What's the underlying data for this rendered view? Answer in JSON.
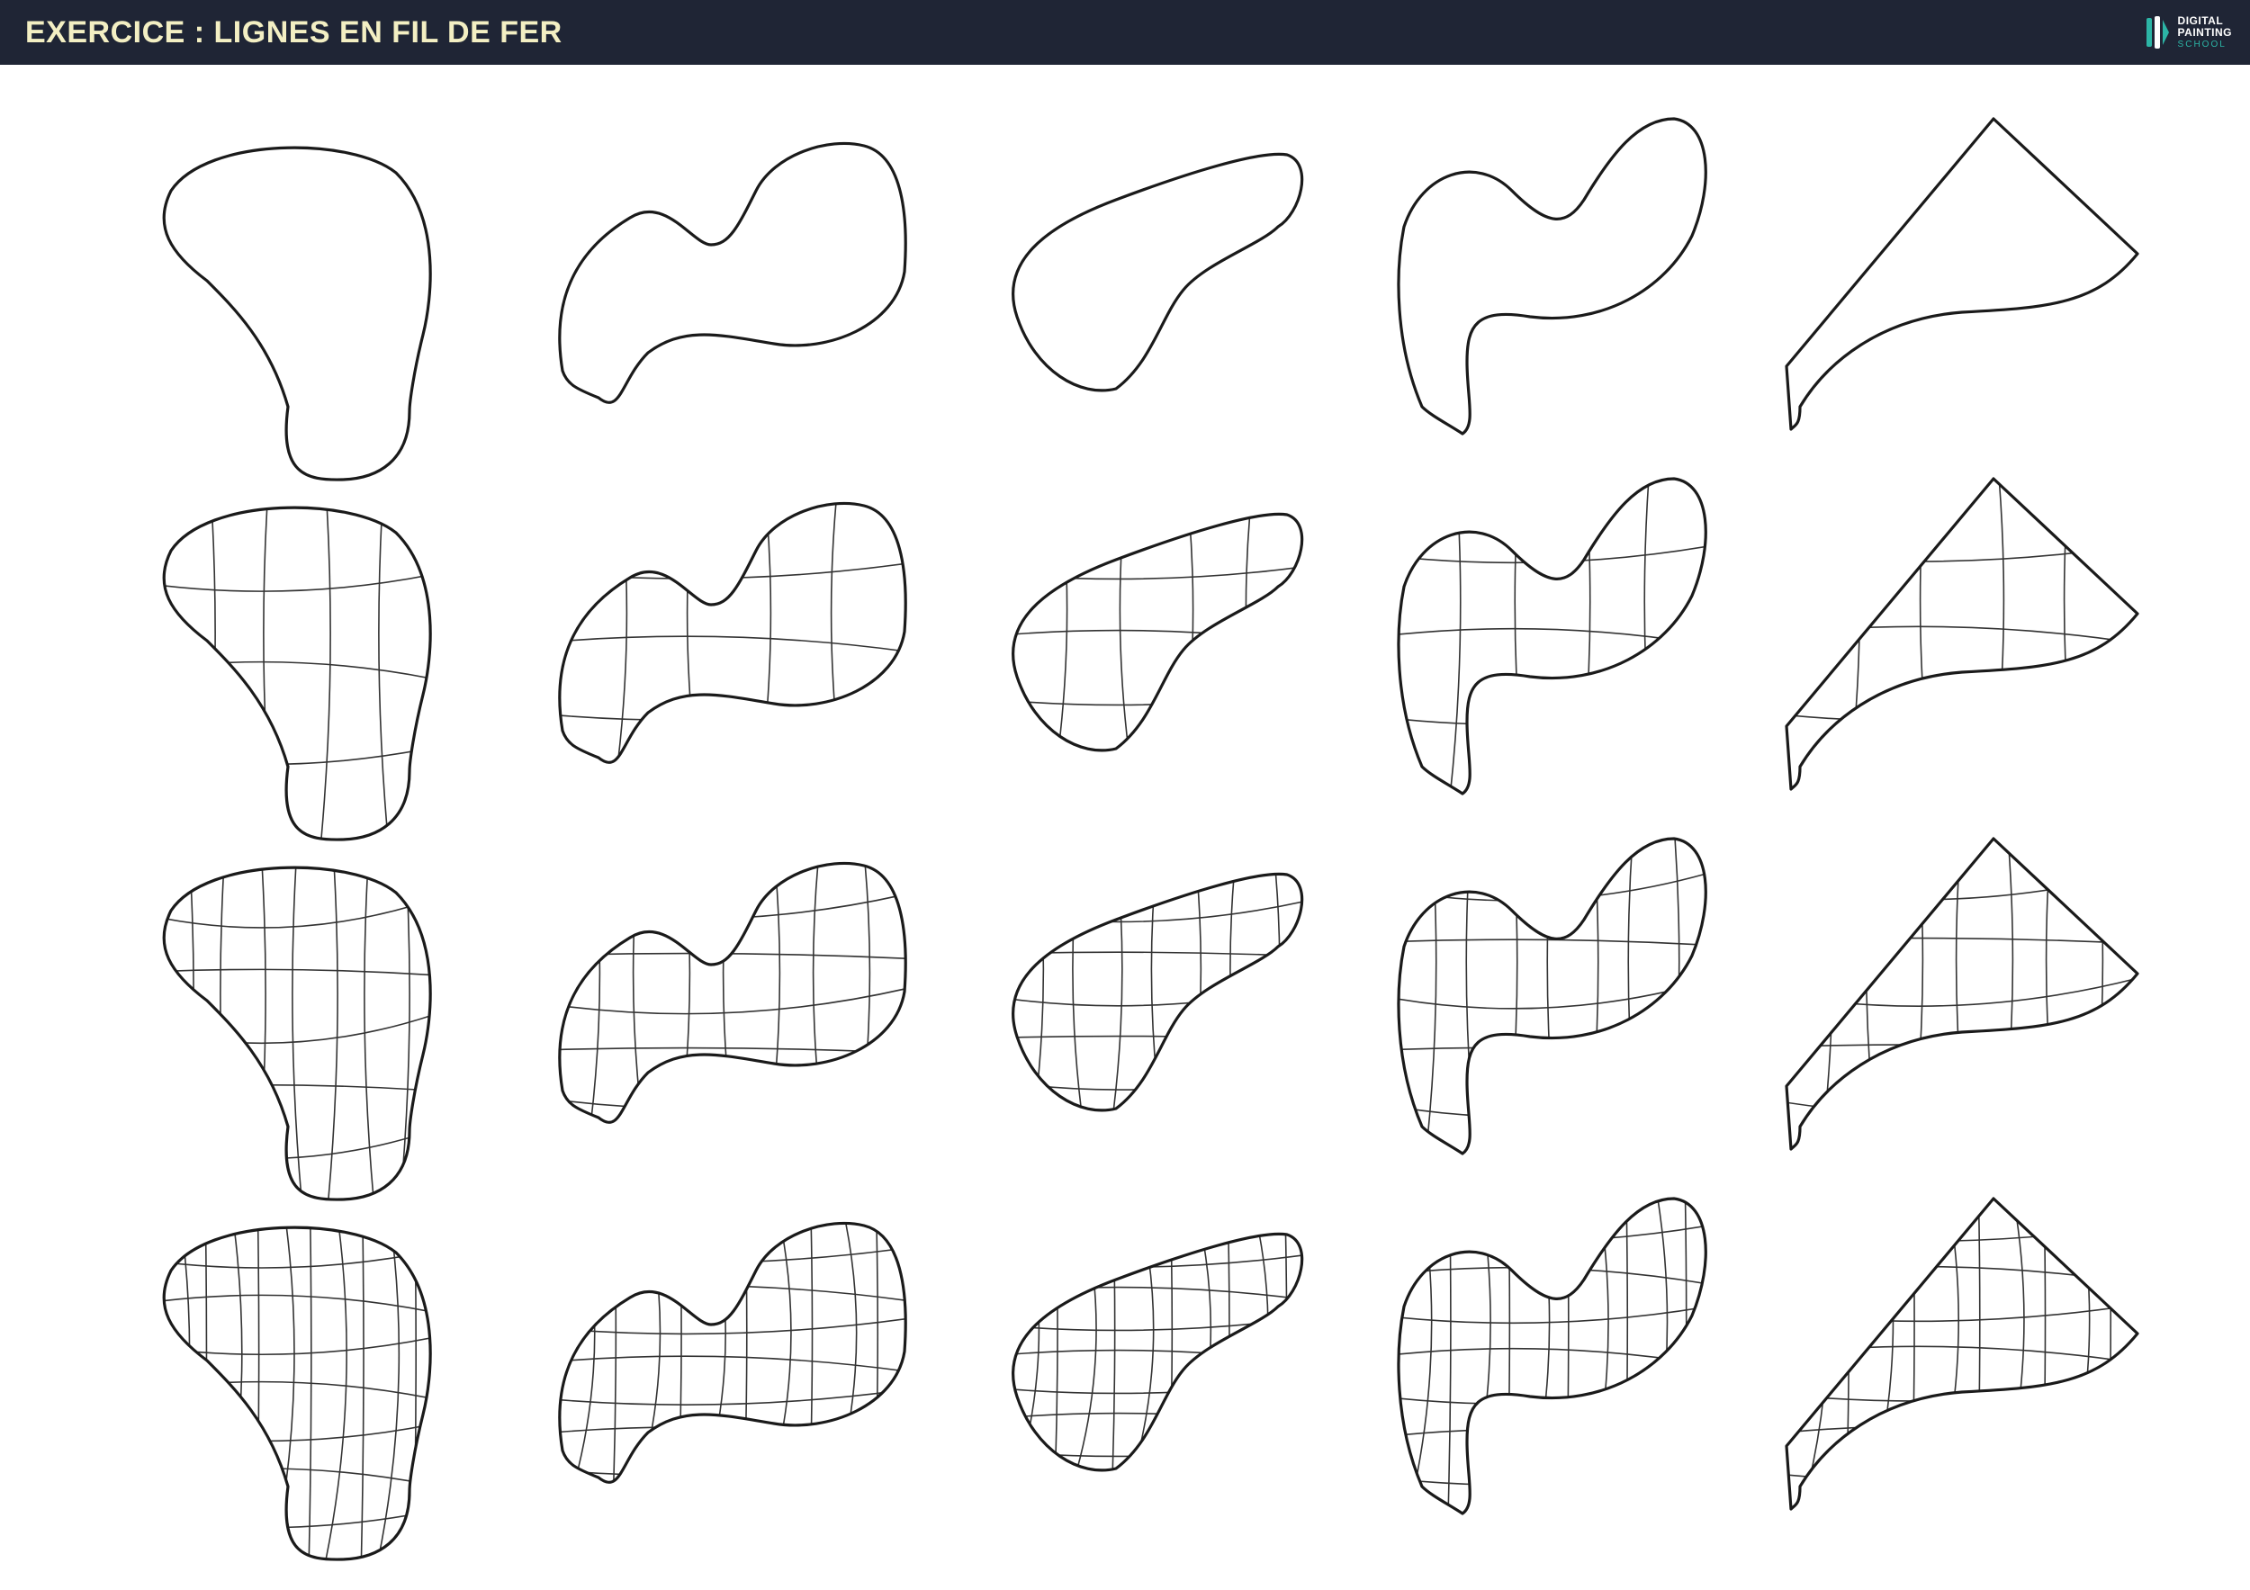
{
  "header": {
    "title": "EXERCICE : LIGNES EN FIL DE FER",
    "logo": {
      "line1": "DIGITAL",
      "line2": "PAINTING",
      "line3": "SCHOOL",
      "icon": "brush-logo-icon"
    }
  },
  "colors": {
    "header_bg": "#1f2535",
    "title": "#f3efc3",
    "accent": "#2cb5a6",
    "ink": "#1a1a1a"
  },
  "grid": {
    "rows": [
      "outline",
      "wireframe-1",
      "wireframe-2",
      "wireframe-3"
    ],
    "columns": [
      "blob",
      "peanut",
      "bean",
      "s-shape",
      "wedge"
    ]
  }
}
